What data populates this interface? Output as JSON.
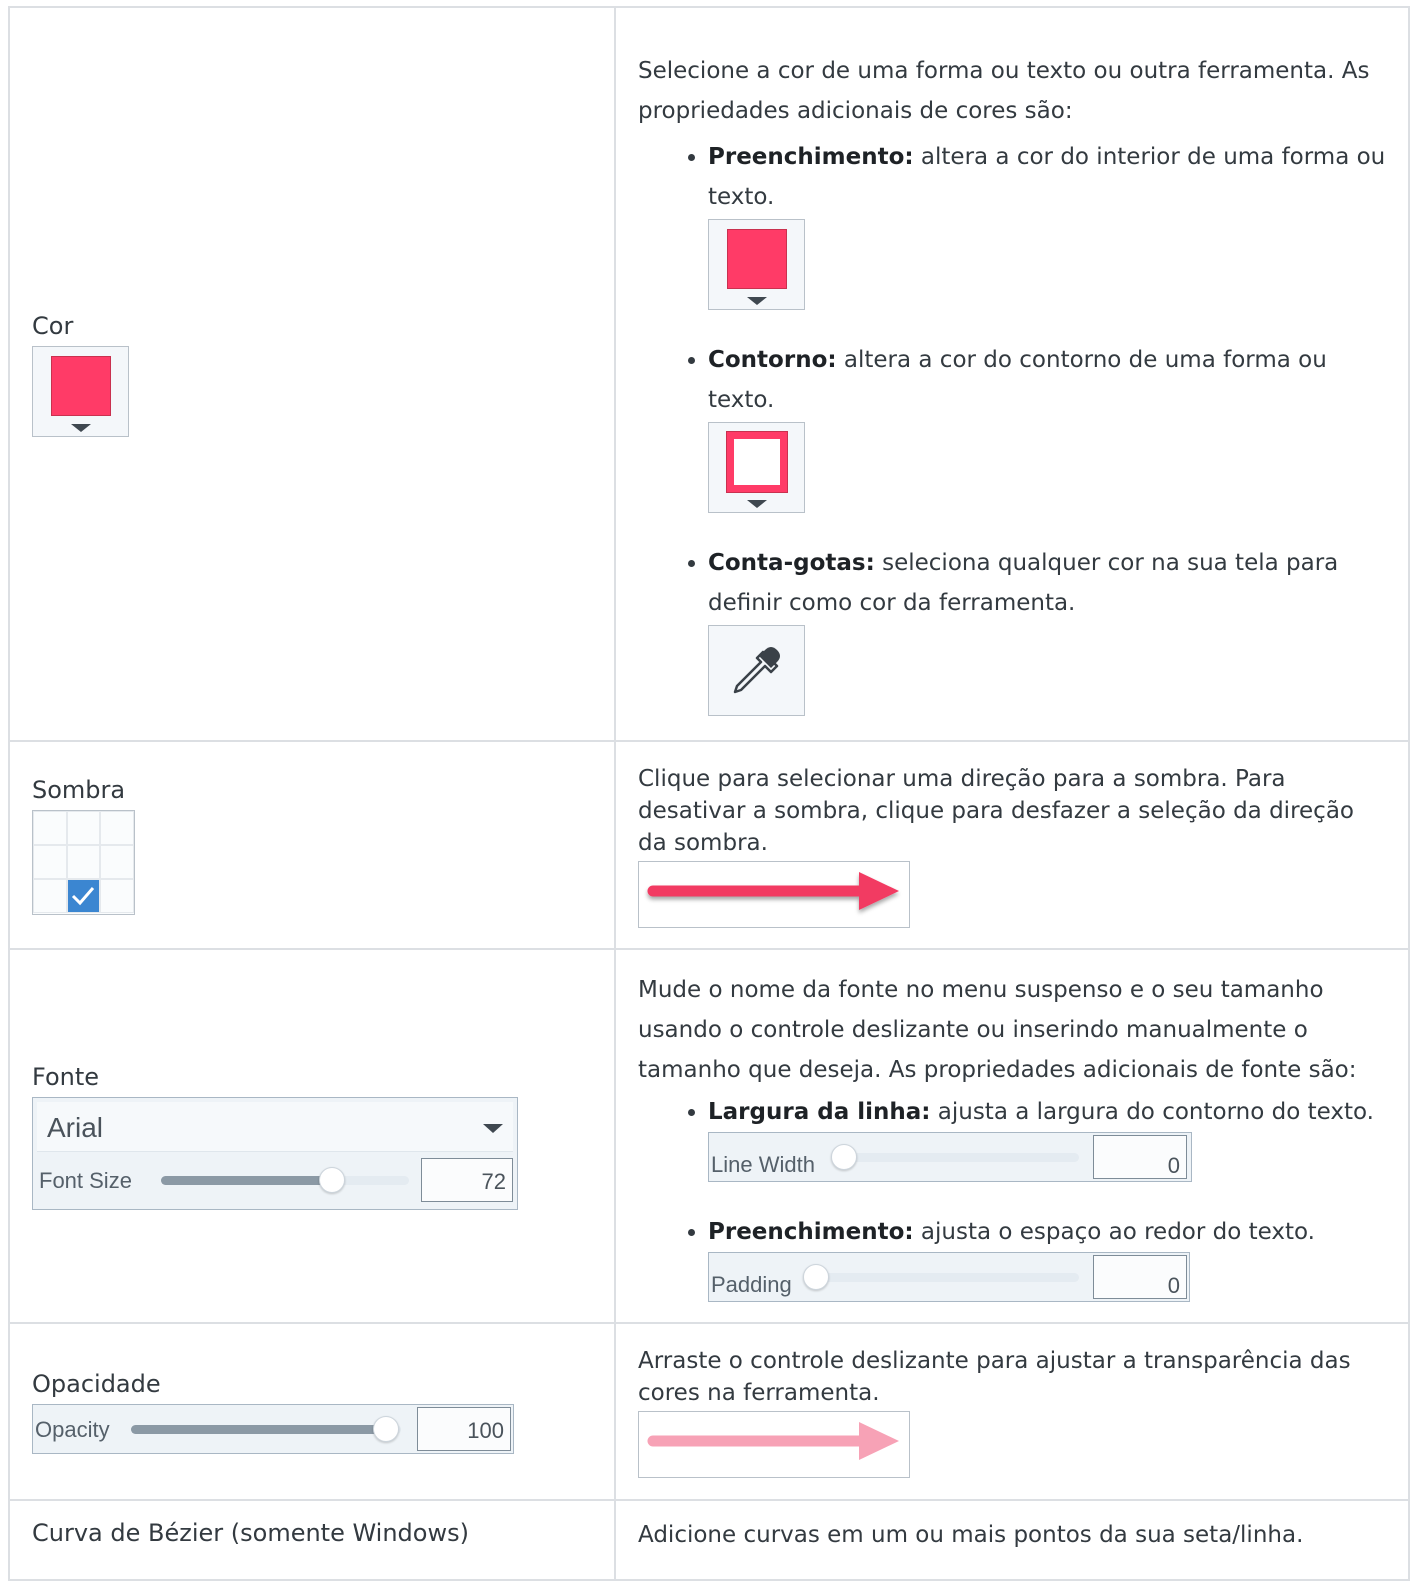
{
  "rows": {
    "color": {
      "label": "Cor",
      "desc": "Selecione a cor de uma forma ou texto ou outra ferramenta. As propriedades adicionais de cores são:",
      "fill_term": "Preenchimento:",
      "fill_text": " altera a cor do interior de uma forma ou texto.",
      "outline_term": "Contorno:",
      "outline_text": " altera a cor do contorno de uma forma ou texto.",
      "dropper_term": "Conta-gotas:",
      "dropper_text": " seleciona qualquer cor na sua tela para definir como cor da ferramenta.",
      "swatch_color": "#ff3b67"
    },
    "shadow": {
      "label": "Sombra",
      "desc": "Clique para selecionar uma direção para a sombra. Para desativar a sombra, clique para desfazer a seleção da direção da sombra."
    },
    "font": {
      "label": "Fonte",
      "font_name": "Arial",
      "font_size_label": "Font Size",
      "font_size_value": "72",
      "font_size_fraction": 0.69,
      "desc": "Mude o nome da fonte no menu suspenso e o seu tamanho usando o controle deslizante ou inserindo manualmente o tamanho que deseja. As propriedades adicionais de fonte são:",
      "line_width_term": "Largura da linha:",
      "line_width_text": " ajusta a largura do contorno do texto.",
      "line_width_label": "Line Width",
      "line_width_value": "0",
      "padding_term": "Preenchimento:",
      "padding_text": " ajusta o espaço ao redor do texto.",
      "padding_label": "Padding",
      "padding_value": "0"
    },
    "opacity": {
      "label": "Opacidade",
      "opacity_label": "Opacity",
      "opacity_value": "100",
      "opacity_fraction": 1.0,
      "desc": "Arraste o controle deslizante para ajustar a transparência das cores na ferramenta."
    },
    "bezier": {
      "label": "Curva de Bézier (somente Windows)",
      "desc": "Adicione curvas em um ou mais pontos da sua seta/linha."
    }
  },
  "colors": {
    "accent_pink": "#ff3b67",
    "arrow_opaque": "#f23a62",
    "arrow_transparent": "#f7a2b6",
    "check_blue": "#3b86d1"
  }
}
